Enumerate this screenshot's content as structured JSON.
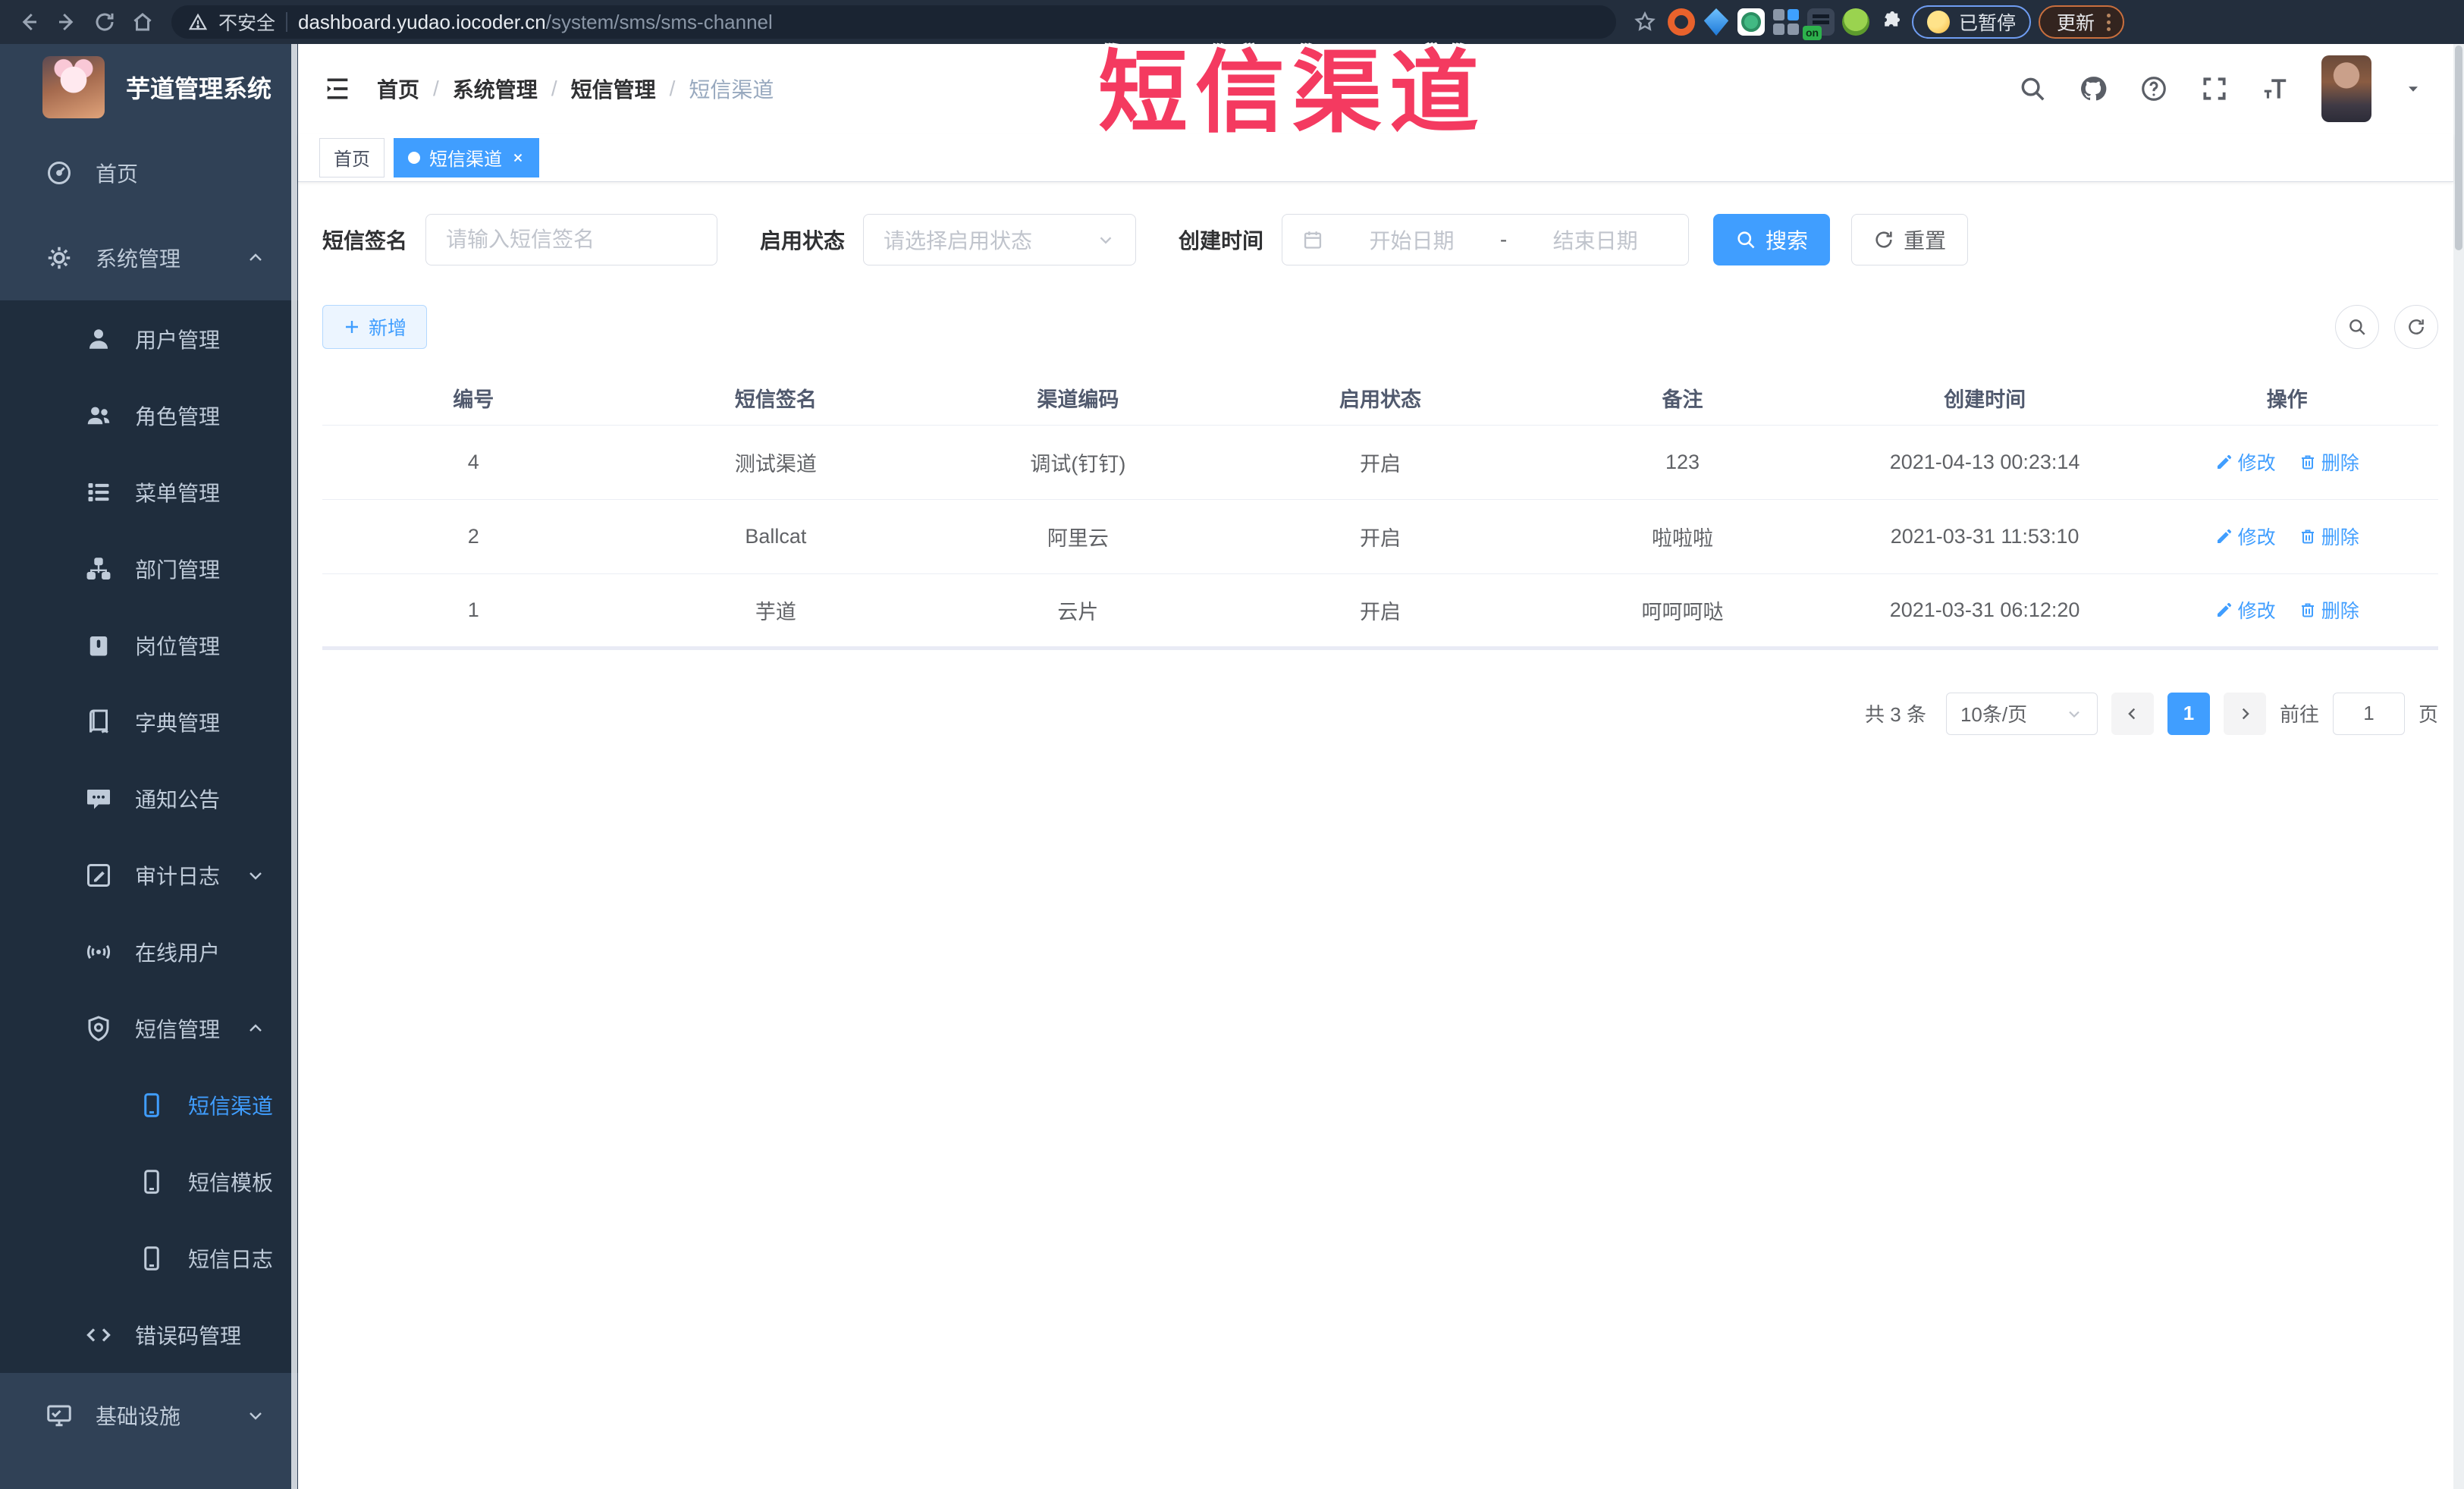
{
  "browser": {
    "security_label": "不安全",
    "url_host": "dashboard.yudao.iocoder.cn",
    "url_path": "/system/sms/sms-channel",
    "ext_badge": "on",
    "paused_label": "已暂停",
    "update_label": "更新"
  },
  "overlay": {
    "title": "短信渠道"
  },
  "sidebar": {
    "app_title": "芋道管理系统",
    "menu": [
      {
        "label": "首页",
        "level": 1,
        "icon": "dashboard-icon"
      },
      {
        "label": "系统管理",
        "level": 1,
        "icon": "gear-icon",
        "chevron": "up"
      },
      {
        "label": "用户管理",
        "level": 2,
        "icon": "user-icon"
      },
      {
        "label": "角色管理",
        "level": 2,
        "icon": "peoples-icon"
      },
      {
        "label": "菜单管理",
        "level": 2,
        "icon": "menu-list-icon"
      },
      {
        "label": "部门管理",
        "level": 2,
        "icon": "tree-icon"
      },
      {
        "label": "岗位管理",
        "level": 2,
        "icon": "post-icon"
      },
      {
        "label": "字典管理",
        "level": 2,
        "icon": "dict-icon"
      },
      {
        "label": "通知公告",
        "level": 2,
        "icon": "message-icon"
      },
      {
        "label": "审计日志",
        "level": 2,
        "icon": "log-icon",
        "chevron": "down"
      },
      {
        "label": "在线用户",
        "level": 2,
        "icon": "online-icon"
      },
      {
        "label": "短信管理",
        "level": 2,
        "icon": "sms-shield-icon",
        "chevron": "up"
      },
      {
        "label": "短信渠道",
        "level": 3,
        "icon": "phone-icon",
        "active": true
      },
      {
        "label": "短信模板",
        "level": 3,
        "icon": "phone-icon"
      },
      {
        "label": "短信日志",
        "level": 3,
        "icon": "phone-icon"
      },
      {
        "label": "错误码管理",
        "level": 2,
        "icon": "code-icon"
      },
      {
        "label": "基础设施",
        "level": 1,
        "icon": "monitor-icon",
        "chevron": "down"
      }
    ]
  },
  "header": {
    "breadcrumb": [
      "首页",
      "系统管理",
      "短信管理",
      "短信渠道"
    ],
    "separator": "/"
  },
  "tabs": [
    {
      "label": "首页",
      "active": false
    },
    {
      "label": "短信渠道",
      "active": true
    }
  ],
  "filters": {
    "signature_label": "短信签名",
    "signature_placeholder": "请输入短信签名",
    "status_label": "启用状态",
    "status_placeholder": "请选择启用状态",
    "created_label": "创建时间",
    "date_start_placeholder": "开始日期",
    "date_separator": "-",
    "date_end_placeholder": "结束日期",
    "search_label": "搜索",
    "reset_label": "重置"
  },
  "toolbar": {
    "add_label": "新增"
  },
  "table": {
    "headers": [
      "编号",
      "短信签名",
      "渠道编码",
      "启用状态",
      "备注",
      "创建时间",
      "操作"
    ],
    "edit_label": "修改",
    "delete_label": "删除",
    "rows": [
      {
        "id": "4",
        "signature": "测试渠道",
        "code": "调试(钉钉)",
        "status": "开启",
        "remark": "123",
        "created": "2021-04-13 00:23:14"
      },
      {
        "id": "2",
        "signature": "Ballcat",
        "code": "阿里云",
        "status": "开启",
        "remark": "啦啦啦",
        "created": "2021-03-31 11:53:10"
      },
      {
        "id": "1",
        "signature": "芋道",
        "code": "云片",
        "status": "开启",
        "remark": "呵呵呵哒",
        "created": "2021-03-31 06:12:20"
      }
    ]
  },
  "pagination": {
    "total_text": "共 3 条",
    "page_size": "10条/页",
    "current_page": "1",
    "goto_label": "前往",
    "goto_value": "1",
    "page_label": "页"
  },
  "colors": {
    "accent": "#409eff",
    "overlay_red": "#f43a60",
    "sidebar_bg": "#304156",
    "submenu_bg": "#1f2d3d"
  }
}
